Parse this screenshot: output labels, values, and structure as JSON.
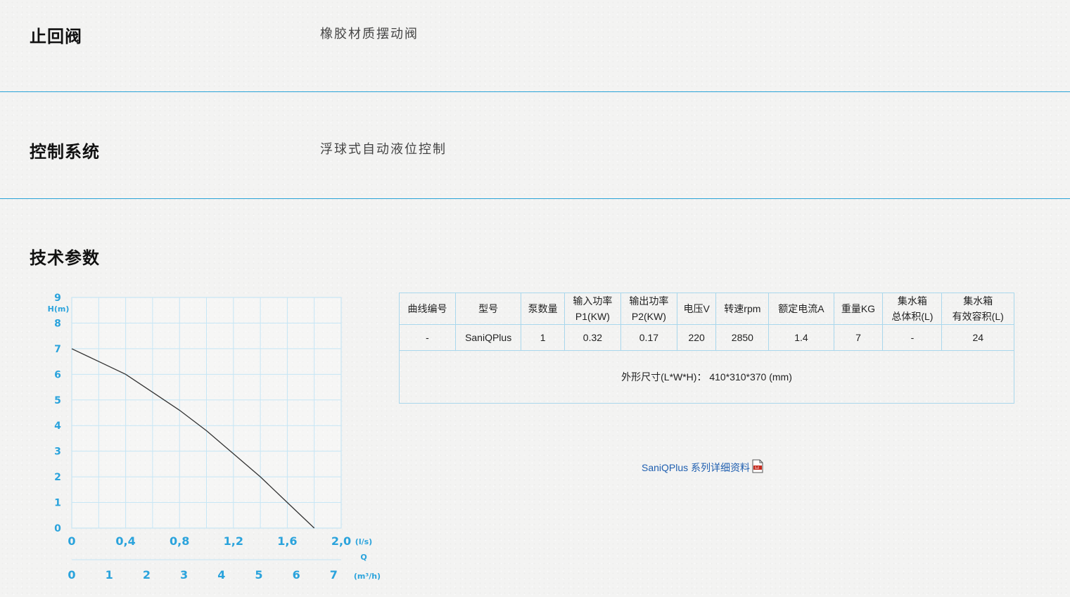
{
  "rows": [
    {
      "label": "止回阀",
      "value": "橡胶材质摆动阀"
    },
    {
      "label": "控制系统",
      "value": "浮球式自动液位控制"
    }
  ],
  "section_title": "技术参数",
  "chart_data": {
    "type": "line",
    "ylabel": "H(m)",
    "ylim": [
      0,
      9
    ],
    "y_ticks": [
      "0",
      "1",
      "2",
      "3",
      "4",
      "5",
      "6",
      "7",
      "8",
      "9"
    ],
    "x_ticks_ls": [
      "0",
      "0,4",
      "0,8",
      "1,2",
      "1,6",
      "2,0"
    ],
    "x_unit_ls": "(l/s)",
    "x_axis_letter": "Q",
    "x_ticks_m3h": [
      "0",
      "1",
      "2",
      "3",
      "4",
      "5",
      "6",
      "7"
    ],
    "x_unit_m3h": "(m³/h)",
    "xlim": [
      0,
      2.0
    ],
    "series": [
      {
        "x": [
          0,
          0.2,
          0.4,
          0.6,
          0.8,
          1.0,
          1.2,
          1.4,
          1.6,
          1.8
        ],
        "y": [
          7.0,
          6.5,
          6.0,
          5.3,
          4.6,
          3.8,
          2.9,
          2.0,
          1.0,
          0.0
        ]
      }
    ]
  },
  "table": {
    "headers": [
      [
        "曲线编号"
      ],
      [
        "型号"
      ],
      [
        "泵数量"
      ],
      [
        "输入功率",
        "P1(KW)"
      ],
      [
        "输出功率",
        "P2(KW)"
      ],
      [
        "电压V"
      ],
      [
        "转速rpm"
      ],
      [
        "额定电流A"
      ],
      [
        "重量KG"
      ],
      [
        "集水箱",
        "总体积(L)"
      ],
      [
        "集水箱",
        "有效容积(L)"
      ]
    ],
    "row": [
      "-",
      "SaniQPlus",
      "1",
      "0.32",
      "0.17",
      "220",
      "2850",
      "1.4",
      "7",
      "-",
      "24"
    ],
    "dimensions": "外形尺寸(L*W*H)：  410*310*370 (mm)"
  },
  "pdf_link": {
    "label": "SaniQPlus 系列详细资料",
    "icon": "pdf-icon"
  }
}
